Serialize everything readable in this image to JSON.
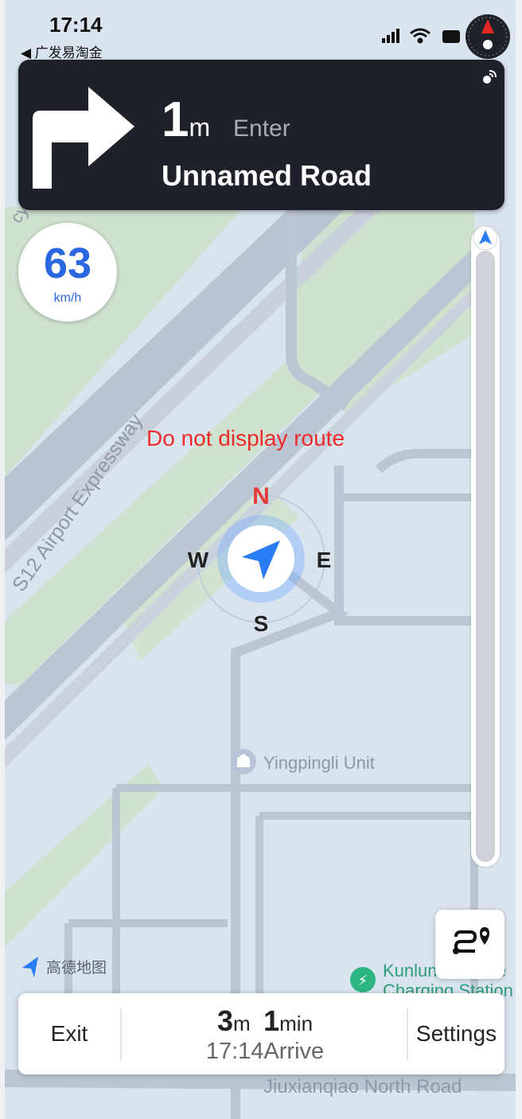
{
  "status_bar": {
    "time": "17:14",
    "back_app": "◀ 广发易淘金"
  },
  "guidance": {
    "distance_value": "1",
    "distance_unit": "m",
    "action": "Enter",
    "road": "Unnamed Road"
  },
  "speed": {
    "value": "63",
    "unit": "km/h"
  },
  "map": {
    "message": "Do not display route",
    "expressway": "S12 Airport Expressway",
    "poi_unit": "Yingpingli Unit",
    "poi_station_line1": "Kunlun",
    "poi_station_line1b": "e",
    "poi_station_line2": "Charging Station",
    "bottom_road": "Jiuxianqiao North Road",
    "compass": {
      "n": "N",
      "e": "E",
      "s": "S",
      "w": "W"
    },
    "logo_text": "高德地图",
    "left_edge_text": "cy"
  },
  "trip": {
    "distance_value": "3",
    "distance_unit": "m",
    "time_value": "1",
    "time_unit": "min",
    "arrive_time": "17:14",
    "arrive_label": "Arrive",
    "exit_label": "Exit",
    "settings_label": "Settings"
  },
  "colors": {
    "nav_card": "#1f2129",
    "speed_blue": "#2a66e0",
    "message_red": "#ee2b2b",
    "map_background": "#d9e4ef",
    "map_green": "#cfe1cf"
  }
}
